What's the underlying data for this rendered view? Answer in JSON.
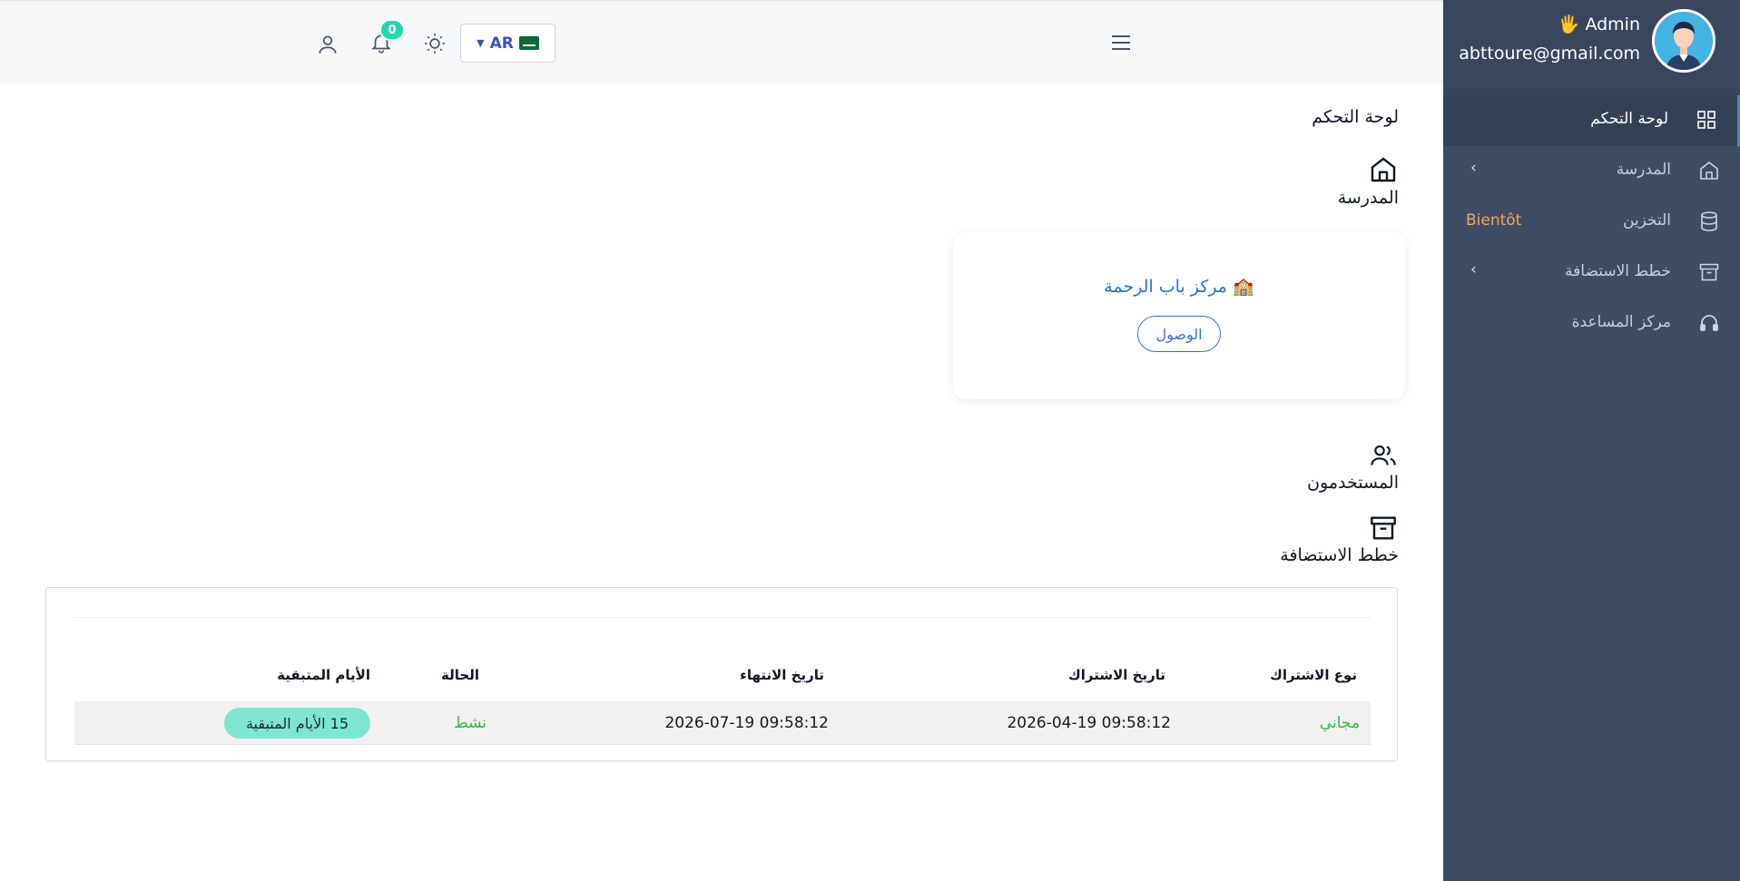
{
  "header": {
    "language_code": "AR",
    "notification_count": "0"
  },
  "sidebar": {
    "admin_name": "Admin",
    "admin_email": "abttoure@gmail.com",
    "items": [
      {
        "label": "لوحة التحكم",
        "icon": "grid-icon",
        "active": true
      },
      {
        "label": "المدرسة",
        "icon": "home-icon",
        "chevron": "‹"
      },
      {
        "label": "التخزين",
        "icon": "database-icon",
        "badge": "Bientôt"
      },
      {
        "label": "خطط الاستضافة",
        "icon": "archive-icon",
        "chevron": "‹"
      },
      {
        "label": "مركز المساعدة",
        "icon": "headphones-icon"
      }
    ]
  },
  "main": {
    "page_title": "لوحة التحكم",
    "school_section_label": "المدرسة",
    "school_card": {
      "name": "مركز باب الرحمة",
      "access_button": "الوصول"
    },
    "users_section_label": "المستخدمون",
    "hosting_section_label": "خطط الاستضافة",
    "subscriptions_table": {
      "headers": {
        "type": "نوع الاشتراك",
        "start": "تاريخ الاشتراك",
        "end": "تاريخ الانتهاء",
        "status": "الحالة",
        "remaining": "الأيام المتبقية"
      },
      "rows": [
        {
          "type": "مجاني",
          "start": "2026-04-19 09:58:12",
          "end": "2026-07-19 09:58:12",
          "status": "نشط",
          "remaining": "15 الأيام المتبقية"
        }
      ]
    }
  },
  "colors": {
    "sidebar_bg": "#3f4c66",
    "accent_blue": "#2e6fdc",
    "status_green": "#2fba4a",
    "badge_orange": "#f5a35c",
    "pill_teal": "#7ee5d0"
  }
}
